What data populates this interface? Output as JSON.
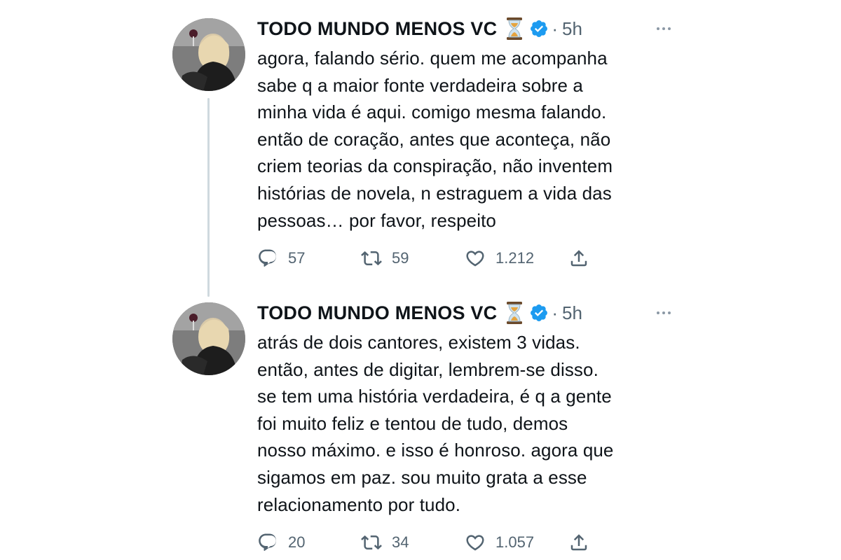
{
  "tweets": [
    {
      "display_name": "TODO MUNDO MENOS VC",
      "time": "5h",
      "separator": "·",
      "text": "agora, falando sério. quem me acompanha\nsabe q a maior fonte verdadeira sobre a\nminha vida é aqui. comigo mesma falando.\nentão de coração, antes que aconteça, não\ncriem teorias da conspiração, não inventem\nhistórias de novela, n estraguem a vida das\npessoas… por favor, respeito",
      "replies": "57",
      "retweets": "59",
      "likes": "1.212"
    },
    {
      "display_name": "TODO MUNDO MENOS VC",
      "time": "5h",
      "separator": "·",
      "text": "atrás de dois cantores, existem 3 vidas.\nentão, antes de digitar, lembrem-se disso.\nse tem uma história verdadeira, é q a gente\nfoi muito feliz e tentou de tudo, demos\nnosso máximo. e isso é honroso. agora que\nsigamos em paz. sou muito grata a esse\nrelacionamento por tudo.",
      "replies": "20",
      "retweets": "34",
      "likes": "1.057"
    }
  ],
  "icons": {
    "name_emoji": "hourglass-icon",
    "badge": "verified-badge-icon",
    "more": "more-options-icon",
    "reply": "reply-icon",
    "retweet": "retweet-icon",
    "like": "heart-icon",
    "share": "share-icon"
  },
  "colors": {
    "text": "#0f1419",
    "secondary_text": "#536471",
    "verified_blue": "#1d9bf0",
    "thread_line": "#cfd9de"
  }
}
